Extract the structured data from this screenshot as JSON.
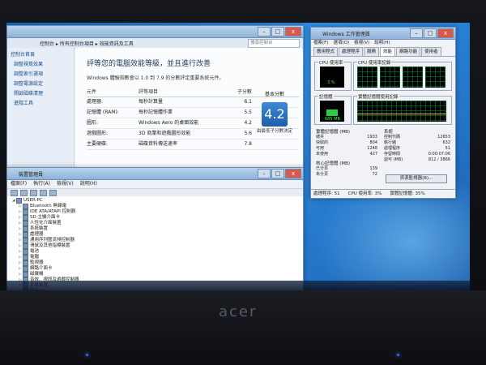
{
  "control_panel": {
    "breadcrumb": [
      "控制台",
      "所有控制台項目",
      "效能資訊及工具"
    ],
    "search_placeholder": "搜尋控制台",
    "sidebar": [
      "控制台首頁",
      "調整視覺效果",
      "調整索引選項",
      "調整電源設定",
      "開啟磁碟清理",
      "進階工具"
    ],
    "heading": "評等您的電腦效能等級，並且進行改善",
    "description": "Windows 體驗指數會以 1.0 到 7.9 的分數評定重要系統元件。",
    "columns": [
      "元件",
      "評等項目",
      "子分數",
      "基本分數"
    ],
    "rows": [
      {
        "component": "處理器:",
        "item": "每秒計算量",
        "score": "6.1"
      },
      {
        "component": "記憶體 (RAM):",
        "item": "每秒記憶體作業",
        "score": "5.5"
      },
      {
        "component": "圖形:",
        "item": "Windows Aero 的桌面效能",
        "score": "4.2"
      },
      {
        "component": "遊戲圖形:",
        "item": "3D 商業和遊戲圖形效能",
        "score": "5.6"
      },
      {
        "component": "主要硬碟:",
        "item": "磁碟資料傳送速率",
        "score": "7.8"
      }
    ],
    "base_score": "4.2",
    "base_score_note": "由最低子分數決定"
  },
  "device_manager": {
    "title": "裝置管理員",
    "menu": [
      "檔案(F)",
      "執行(A)",
      "檢視(V)",
      "說明(H)"
    ],
    "root": "USER-PC",
    "nodes": [
      "Bluetooth 無線電",
      "IDE ATA/ATAPI 控制器",
      "SD 主機介面卡",
      "人性化介面裝置",
      "系統裝置",
      "處理器",
      "通用序列匯流排控制器",
      "滑鼠及其他指標裝置",
      "電池",
      "電腦",
      "監視器",
      "網路介面卡",
      "磁碟機",
      "音效、視訊及遊戲控制器",
      "影像裝置",
      "顯示卡"
    ]
  },
  "task_manager": {
    "title": "Windows 工作管理員",
    "menu": [
      "檔案(F)",
      "選項(O)",
      "檢視(V)",
      "說明(H)"
    ],
    "tabs": [
      "應用程式",
      "處理程序",
      "服務",
      "效能",
      "網路功能",
      "使用者"
    ],
    "active_tab": "效能",
    "cpu_usage_label": "CPU 使用率",
    "cpu_history_label": "CPU 使用率記錄",
    "cpu_usage_value": "3 %",
    "memory_label": "記憶體",
    "memory_history_label": "實體記憶體使用記錄",
    "memory_value": "685 MB",
    "physical_memory_title": "實體記憶體 (MB)",
    "physical_memory": [
      {
        "label": "總共",
        "value": "1933"
      },
      {
        "label": "快取的",
        "value": "804"
      },
      {
        "label": "可用",
        "value": "1248"
      },
      {
        "label": "未使用",
        "value": "427"
      }
    ],
    "system_title": "系統",
    "system": [
      {
        "label": "控制代碼",
        "value": "12653"
      },
      {
        "label": "執行緒",
        "value": "632"
      },
      {
        "label": "處理程序",
        "value": "51"
      },
      {
        "label": "存留時間",
        "value": "0:00:07:06"
      },
      {
        "label": "認可 (MB)",
        "value": "812 / 3866"
      }
    ],
    "kernel_title": "核心記憶體 (MB)",
    "kernel": [
      {
        "label": "已分頁",
        "value": "139"
      },
      {
        "label": "未分頁",
        "value": "72"
      }
    ],
    "resource_monitor_button": "資源監視器(R)...",
    "status": {
      "processes": "處理程序: 51",
      "cpu": "CPU 使用率: 3%",
      "memory": "實體記憶體: 35%"
    }
  },
  "laptop": {
    "brand": "acer"
  }
}
